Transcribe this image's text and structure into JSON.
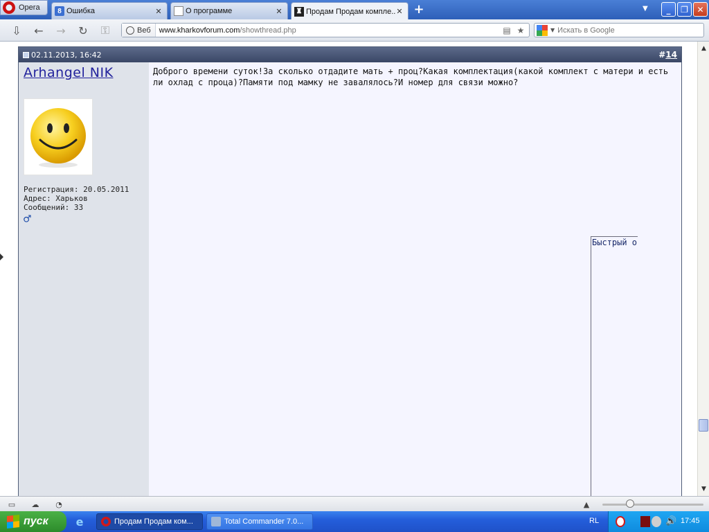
{
  "browser": {
    "menu_label": "Opera",
    "tabs": [
      {
        "label": "Ошибка",
        "icon": "google-icon"
      },
      {
        "label": "О программе",
        "icon": "document-icon"
      },
      {
        "label": "Продам Продам компле...",
        "icon": "forum-icon"
      }
    ],
    "address": {
      "mode_label": "Веб",
      "url_host": "www.kharkovforum.com",
      "url_path": "/showthread.php"
    },
    "search": {
      "placeholder": "Искать в Google"
    }
  },
  "post": {
    "date": "02.11.2013, 16:42",
    "number_prefix": "#",
    "number": "14",
    "author": "Arhangel NIK",
    "registration": "Регистрация: 20.05.2011",
    "address": "Адрес: Харьков",
    "messages": "Сообщений: 33",
    "gender_symbol": "♂",
    "message_text": "Доброго времени суток!За сколько отдадите мать + проц?Какая комплектация(какой комплект с матери и есть ли охлад с проца)?Памяти под мамку не завалялось?И номер для связи можно?"
  },
  "quick_reply": {
    "label": "Быстрый о"
  },
  "taskbar": {
    "start_label": "пуск",
    "tasks": [
      {
        "label": "Продам Продам ком...",
        "active": true
      },
      {
        "label": "Total Commander 7.0...",
        "active": false
      }
    ],
    "language": "RL",
    "clock": "17:45"
  },
  "colors": {
    "post_header": "#46536f",
    "username": "#22229c",
    "taskbar": "#245edb"
  }
}
